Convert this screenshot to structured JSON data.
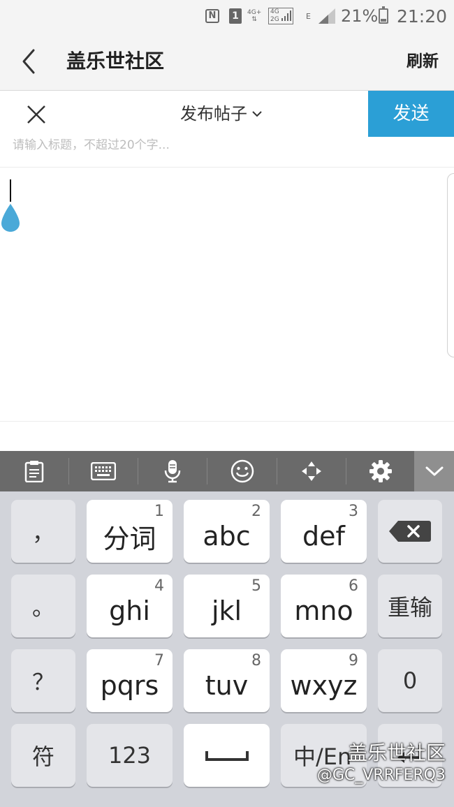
{
  "status_bar": {
    "network_plus": "4G+",
    "network_combo_top": "4G",
    "network_combo_bottom": "2G",
    "edge": "E",
    "sim": "1",
    "battery_percent": "21%",
    "time": "21:20"
  },
  "app_bar": {
    "title": "盖乐世社区",
    "refresh_label": "刷新"
  },
  "compose": {
    "post_type": "发布帖子",
    "send_label": "发送",
    "title_placeholder": "请输入标题，不超过20个字..."
  },
  "keyboard": {
    "keys": [
      {
        "label": "，",
        "number": ""
      },
      {
        "label": "分词",
        "number": "1"
      },
      {
        "label": "abc",
        "number": "2"
      },
      {
        "label": "def",
        "number": "3"
      },
      {
        "label": "。",
        "number": ""
      },
      {
        "label": "ghi",
        "number": "4"
      },
      {
        "label": "jkl",
        "number": "5"
      },
      {
        "label": "mno",
        "number": "6"
      },
      {
        "label": "重输",
        "number": ""
      },
      {
        "label": "？",
        "number": ""
      },
      {
        "label": "pqrs",
        "number": "7"
      },
      {
        "label": "tuv",
        "number": "8"
      },
      {
        "label": "wxyz",
        "number": "9"
      },
      {
        "label": "0",
        "number": ""
      },
      {
        "label": "符",
        "number": ""
      },
      {
        "label": "123",
        "number": ""
      },
      {
        "label": "中/En",
        "number": ""
      }
    ]
  },
  "watermark": {
    "line1": "盖乐世社区",
    "line2": "@GC_VRRFERQ3"
  },
  "colors": {
    "accent": "#2b9fd6",
    "caret_handle": "#4aa9d8",
    "toolbar": "#6a6a6a",
    "keyboard_bg": "#d2d4da"
  }
}
